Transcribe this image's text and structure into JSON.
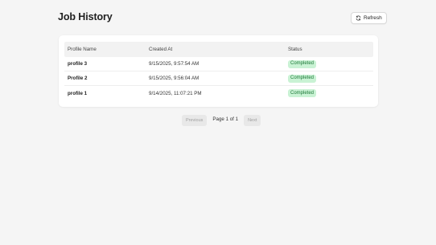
{
  "header": {
    "title": "Job History",
    "refresh_label": "Refresh"
  },
  "table": {
    "columns": [
      "Profile Name",
      "Created At",
      "Status"
    ],
    "rows": [
      {
        "profile": "profile 3",
        "created_at": "9/15/2025, 9:57:54 AM",
        "status": "Completed"
      },
      {
        "profile": "Profile 2",
        "created_at": "9/15/2025, 9:56:04 AM",
        "status": "Completed"
      },
      {
        "profile": "profile 1",
        "created_at": "9/14/2025, 11:07:21 PM",
        "status": "Completed"
      }
    ]
  },
  "pagination": {
    "previous_label": "Previous",
    "info": "Page 1 of 1",
    "next_label": "Next"
  },
  "icons": {
    "refresh": "refresh-icon"
  },
  "colors": {
    "background": "#f5f5f5",
    "status_completed_bg": "#c9f2d4",
    "status_completed_text": "#1f7a3a"
  }
}
